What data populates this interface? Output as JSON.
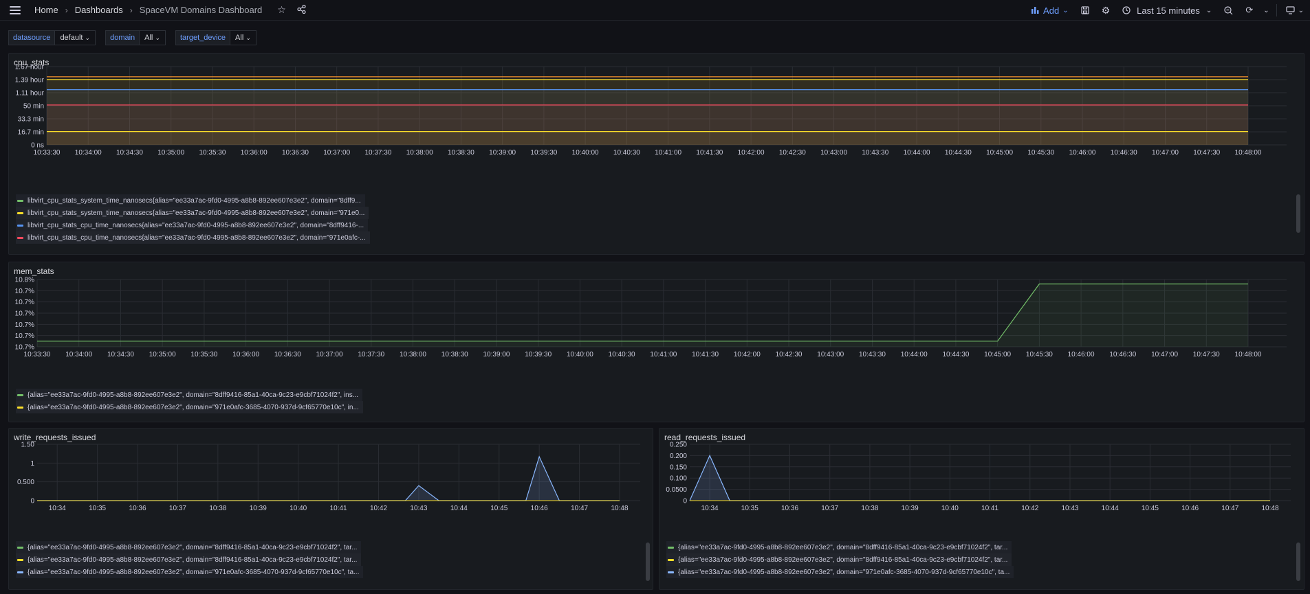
{
  "topbar": {
    "breadcrumbs": [
      "Home",
      "Dashboards",
      "SpaceVM Domains Dashboard"
    ],
    "add_label": "Add",
    "time_range": "Last 15 minutes"
  },
  "variables": [
    {
      "name": "datasource",
      "value": "default"
    },
    {
      "name": "domain",
      "value": "All"
    },
    {
      "name": "target_device",
      "value": "All"
    }
  ],
  "colors": {
    "green": "#73bf69",
    "yellow": "#fade2a",
    "blue": "#5794f2",
    "red": "#f2495c",
    "cyan": "#8ab8ff",
    "orange": "#ff9830"
  },
  "panels": {
    "cpu": {
      "title": "cpu_stats",
      "legend": [
        {
          "text": "libvirt_cpu_stats_system_time_nanosecs{alias=\"ee33a7ac-9fd0-4995-a8b8-892ee607e3e2\", domain=\"8dff9...",
          "color": "#73bf69"
        },
        {
          "text": "libvirt_cpu_stats_system_time_nanosecs{alias=\"ee33a7ac-9fd0-4995-a8b8-892ee607e3e2\", domain=\"971e0...",
          "color": "#fade2a"
        },
        {
          "text": "libvirt_cpu_stats_cpu_time_nanosecs{alias=\"ee33a7ac-9fd0-4995-a8b8-892ee607e3e2\", domain=\"8dff9416-...",
          "color": "#5794f2"
        },
        {
          "text": "libvirt_cpu_stats_cpu_time_nanosecs{alias=\"ee33a7ac-9fd0-4995-a8b8-892ee607e3e2\", domain=\"971e0afc-...",
          "color": "#f2495c"
        }
      ]
    },
    "mem": {
      "title": "mem_stats",
      "legend": [
        {
          "text": "{alias=\"ee33a7ac-9fd0-4995-a8b8-892ee607e3e2\", domain=\"8dff9416-85a1-40ca-9c23-e9cbf71024f2\", ins...",
          "color": "#73bf69"
        },
        {
          "text": "{alias=\"ee33a7ac-9fd0-4995-a8b8-892ee607e3e2\", domain=\"971e0afc-3685-4070-937d-9cf65770e10c\", in...",
          "color": "#fade2a"
        }
      ]
    },
    "write": {
      "title": "write_requests_issued",
      "legend": [
        {
          "text": "{alias=\"ee33a7ac-9fd0-4995-a8b8-892ee607e3e2\", domain=\"8dff9416-85a1-40ca-9c23-e9cbf71024f2\", tar...",
          "color": "#73bf69"
        },
        {
          "text": "{alias=\"ee33a7ac-9fd0-4995-a8b8-892ee607e3e2\", domain=\"8dff9416-85a1-40ca-9c23-e9cbf71024f2\", tar...",
          "color": "#fade2a"
        },
        {
          "text": "{alias=\"ee33a7ac-9fd0-4995-a8b8-892ee607e3e2\", domain=\"971e0afc-3685-4070-937d-9cf65770e10c\", ta...",
          "color": "#8ab8ff"
        }
      ]
    },
    "read": {
      "title": "read_requests_issued",
      "legend": [
        {
          "text": "{alias=\"ee33a7ac-9fd0-4995-a8b8-892ee607e3e2\", domain=\"8dff9416-85a1-40ca-9c23-e9cbf71024f2\", tar...",
          "color": "#73bf69"
        },
        {
          "text": "{alias=\"ee33a7ac-9fd0-4995-a8b8-892ee607e3e2\", domain=\"8dff9416-85a1-40ca-9c23-e9cbf71024f2\", tar...",
          "color": "#fade2a"
        },
        {
          "text": "{alias=\"ee33a7ac-9fd0-4995-a8b8-892ee607e3e2\", domain=\"971e0afc-3685-4070-937d-9cf65770e10c\", ta...",
          "color": "#8ab8ff"
        }
      ]
    }
  },
  "chart_data": [
    {
      "type": "line",
      "title": "cpu_stats",
      "y_ticks": [
        "0 ns",
        "16.7 min",
        "33.3 min",
        "50 min",
        "1.11 hour",
        "1.39 hour",
        "1.67 hour"
      ],
      "ylim_minutes": [
        0,
        100
      ],
      "x_ticks": [
        "10:33:30",
        "10:34:00",
        "10:34:30",
        "10:35:00",
        "10:35:30",
        "10:36:00",
        "10:36:30",
        "10:37:00",
        "10:37:30",
        "10:38:00",
        "10:38:30",
        "10:39:00",
        "10:39:30",
        "10:40:00",
        "10:40:30",
        "10:41:00",
        "10:41:30",
        "10:42:00",
        "10:42:30",
        "10:43:00",
        "10:43:30",
        "10:44:00",
        "10:44:30",
        "10:45:00",
        "10:45:30",
        "10:46:00",
        "10:46:30",
        "10:47:00",
        "10:47:30",
        "10:48:00"
      ],
      "series": [
        {
          "color": "#ff9830",
          "values_minutes": [
            87,
            87
          ]
        },
        {
          "color": "#fade2a",
          "values_minutes": [
            83.5,
            83.5
          ]
        },
        {
          "color": "#5794f2",
          "values_minutes": [
            70.5,
            70.5
          ]
        },
        {
          "color": "#f2495c",
          "values_minutes": [
            51,
            51
          ]
        },
        {
          "color": "#fade2a",
          "values_minutes": [
            17,
            17
          ]
        }
      ]
    },
    {
      "type": "line",
      "title": "mem_stats",
      "y_ticks": [
        "10.7%",
        "10.7%",
        "10.7%",
        "10.7%",
        "10.7%",
        "10.7%",
        "10.8%"
      ],
      "ylim": [
        0,
        6
      ],
      "x_ticks": [
        "10:33:30",
        "10:34:00",
        "10:34:30",
        "10:35:00",
        "10:35:30",
        "10:36:00",
        "10:36:30",
        "10:37:00",
        "10:37:30",
        "10:38:00",
        "10:38:30",
        "10:39:00",
        "10:39:30",
        "10:40:00",
        "10:40:30",
        "10:41:00",
        "10:41:30",
        "10:42:00",
        "10:42:30",
        "10:43:00",
        "10:43:30",
        "10:44:00",
        "10:44:30",
        "10:45:00",
        "10:45:30",
        "10:46:00",
        "10:46:30",
        "10:47:00",
        "10:47:30",
        "10:48:00"
      ],
      "series": [
        {
          "color": "#73bf69",
          "x": [
            "10:33:30",
            "10:45:00",
            "10:45:30",
            "10:48:00"
          ],
          "values": [
            0.5,
            0.5,
            5.6,
            5.6
          ]
        }
      ]
    },
    {
      "type": "line",
      "title": "write_requests_issued",
      "y_ticks": [
        "0",
        "0.500",
        "1",
        "1.50"
      ],
      "ylim": [
        0,
        1.5
      ],
      "x_ticks": [
        "10:34",
        "10:35",
        "10:36",
        "10:37",
        "10:38",
        "10:39",
        "10:40",
        "10:41",
        "10:42",
        "10:43",
        "10:44",
        "10:45",
        "10:46",
        "10:47",
        "10:48"
      ],
      "series": [
        {
          "color": "#8ab8ff",
          "x": [
            "10:33:30",
            "10:42:40",
            "10:43:00",
            "10:43:30",
            "10:45:40",
            "10:46:00",
            "10:46:30",
            "10:48:00"
          ],
          "values": [
            0,
            0,
            0.4,
            0,
            0,
            1.17,
            0,
            0
          ]
        }
      ]
    },
    {
      "type": "line",
      "title": "read_requests_issued",
      "y_ticks": [
        "0",
        "0.0500",
        "0.100",
        "0.150",
        "0.200",
        "0.250"
      ],
      "ylim": [
        0,
        0.25
      ],
      "x_ticks": [
        "10:34",
        "10:35",
        "10:36",
        "10:37",
        "10:38",
        "10:39",
        "10:40",
        "10:41",
        "10:42",
        "10:43",
        "10:44",
        "10:45",
        "10:46",
        "10:47",
        "10:48"
      ],
      "series": [
        {
          "color": "#8ab8ff",
          "x": [
            "10:33:30",
            "10:34:00",
            "10:34:30",
            "10:48:00"
          ],
          "values": [
            0,
            0.2,
            0,
            0
          ]
        }
      ]
    }
  ]
}
